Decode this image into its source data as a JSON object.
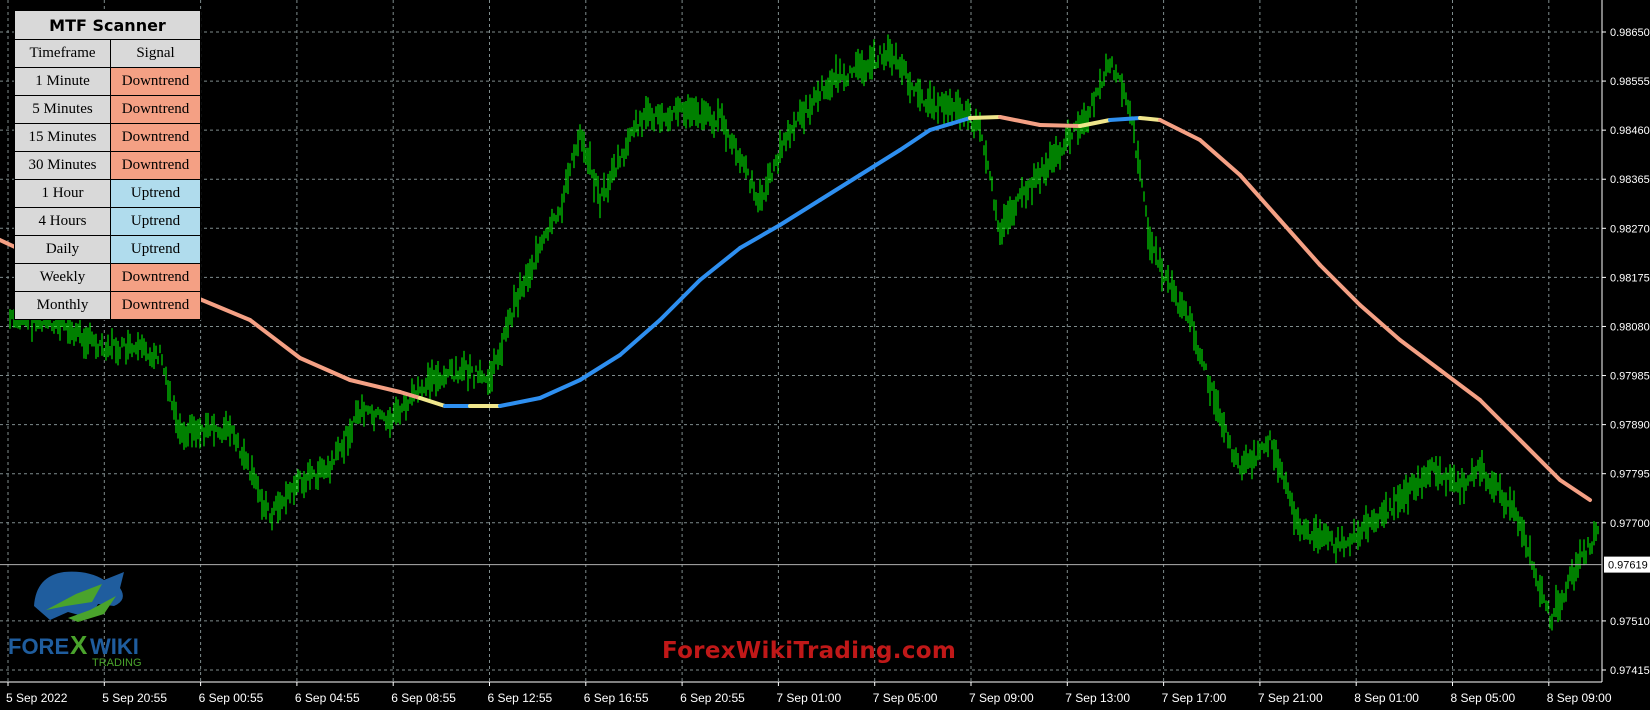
{
  "scanner": {
    "title": "MTF Scanner",
    "col_timeframe": "Timeframe",
    "col_signal": "Signal",
    "rows": [
      {
        "timeframe": "1 Minute",
        "signal": "Downtrend"
      },
      {
        "timeframe": "5 Minutes",
        "signal": "Downtrend"
      },
      {
        "timeframe": "15 Minutes",
        "signal": "Downtrend"
      },
      {
        "timeframe": "30 Minutes",
        "signal": "Downtrend"
      },
      {
        "timeframe": "1 Hour",
        "signal": "Uptrend"
      },
      {
        "timeframe": "4 Hours",
        "signal": "Uptrend"
      },
      {
        "timeframe": "Daily",
        "signal": "Uptrend"
      },
      {
        "timeframe": "Weekly",
        "signal": "Downtrend"
      },
      {
        "timeframe": "Monthly",
        "signal": "Downtrend"
      }
    ],
    "colors": {
      "Downtrend": "#f4a084",
      "Uptrend": "#b0dced"
    }
  },
  "price_axis": {
    "ticks": [
      "0.98650",
      "0.98555",
      "0.98460",
      "0.98365",
      "0.98270",
      "0.98175",
      "0.98080",
      "0.97985",
      "0.97890",
      "0.97795",
      "0.97700",
      "0.97510",
      "0.97415"
    ],
    "current_price": "0.97619"
  },
  "time_axis": {
    "ticks": [
      "5 Sep 2022",
      "5 Sep 20:55",
      "6 Sep 00:55",
      "6 Sep 04:55",
      "6 Sep 08:55",
      "6 Sep 12:55",
      "6 Sep 16:55",
      "6 Sep 20:55",
      "7 Sep 01:00",
      "7 Sep 05:00",
      "7 Sep 09:00",
      "7 Sep 13:00",
      "7 Sep 17:00",
      "7 Sep 21:00",
      "8 Sep 01:00",
      "8 Sep 05:00",
      "8 Sep 09:00"
    ]
  },
  "logo": {
    "text_left": "FORE",
    "text_mid": "X",
    "text_right": "WIKI",
    "subtext": "TRADING"
  },
  "watermark": "ForexWikiTrading.com",
  "colors": {
    "price_line": "#00ff00",
    "grid": "#7f8c8d",
    "ma_downtrend": "#f4a084",
    "ma_uptrend": "#2e8ff0",
    "ma_neutral": "#f0e68c",
    "axis_text": "#ffffff"
  }
}
